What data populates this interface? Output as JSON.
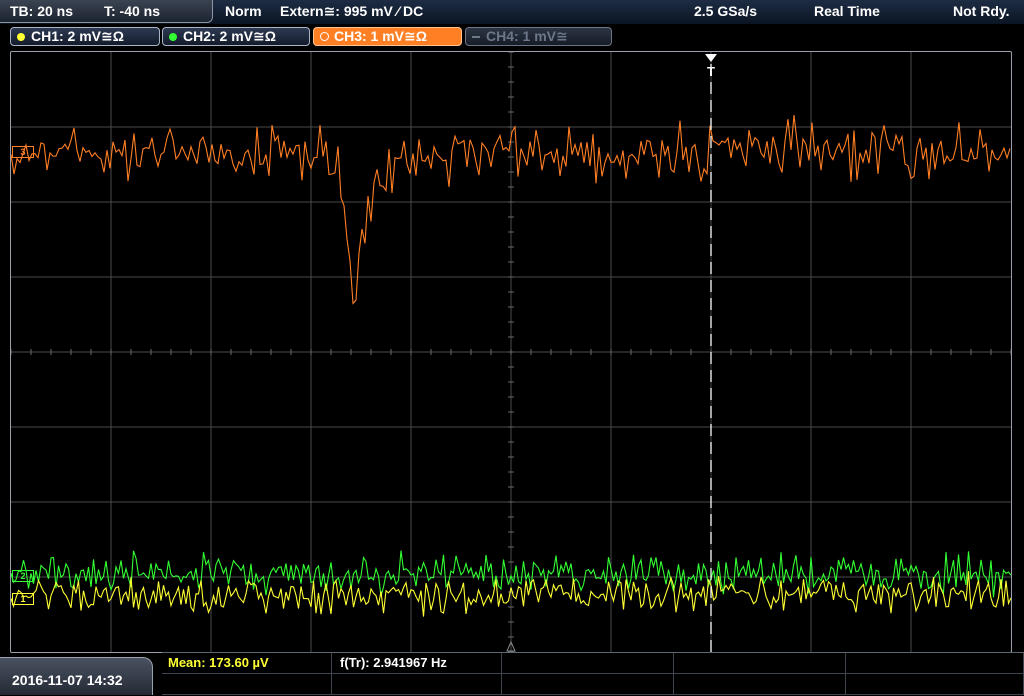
{
  "status_bar": {
    "timebase": "TB: 20 ns",
    "trigger_time": "T: -40 ns",
    "trigger_mode": "Norm",
    "trigger_source": "Extern≅: 995 mV ⁄ DC",
    "sample_rate": "2.5 GSa/s",
    "acquisition_mode": "Real Time",
    "state": "Not Rdy."
  },
  "channels": [
    {
      "label": "CH1: 2 mV≅Ω",
      "color": "#ffff33",
      "active": false,
      "enabled": true
    },
    {
      "label": "CH2: 2 mV≅Ω",
      "color": "#33ff33",
      "active": false,
      "enabled": true
    },
    {
      "label": "CH3: 1 mV≅Ω",
      "color": "#ff7f24",
      "active": true,
      "enabled": true
    },
    {
      "label": "CH4: 1 mV≅",
      "color": "#6d7788",
      "active": false,
      "enabled": false
    }
  ],
  "screen": {
    "trigger_marker": "T",
    "ch3_marker": "3",
    "ch2_marker": "2",
    "ch1_marker": "1",
    "grid_color": "#4a4a4a",
    "trace_colors": {
      "ch1": "#ffff33",
      "ch2": "#33ff33",
      "ch3": "#ff7f24"
    }
  },
  "bottom_bar": {
    "datetime": "2016-11-07 14:32",
    "measurements": [
      {
        "label": "Mean: 173.60 µV",
        "color": "#ffff33"
      },
      {
        "label": "f(Tr): 2.941967 Hz",
        "color": "#ffffff"
      }
    ]
  }
}
